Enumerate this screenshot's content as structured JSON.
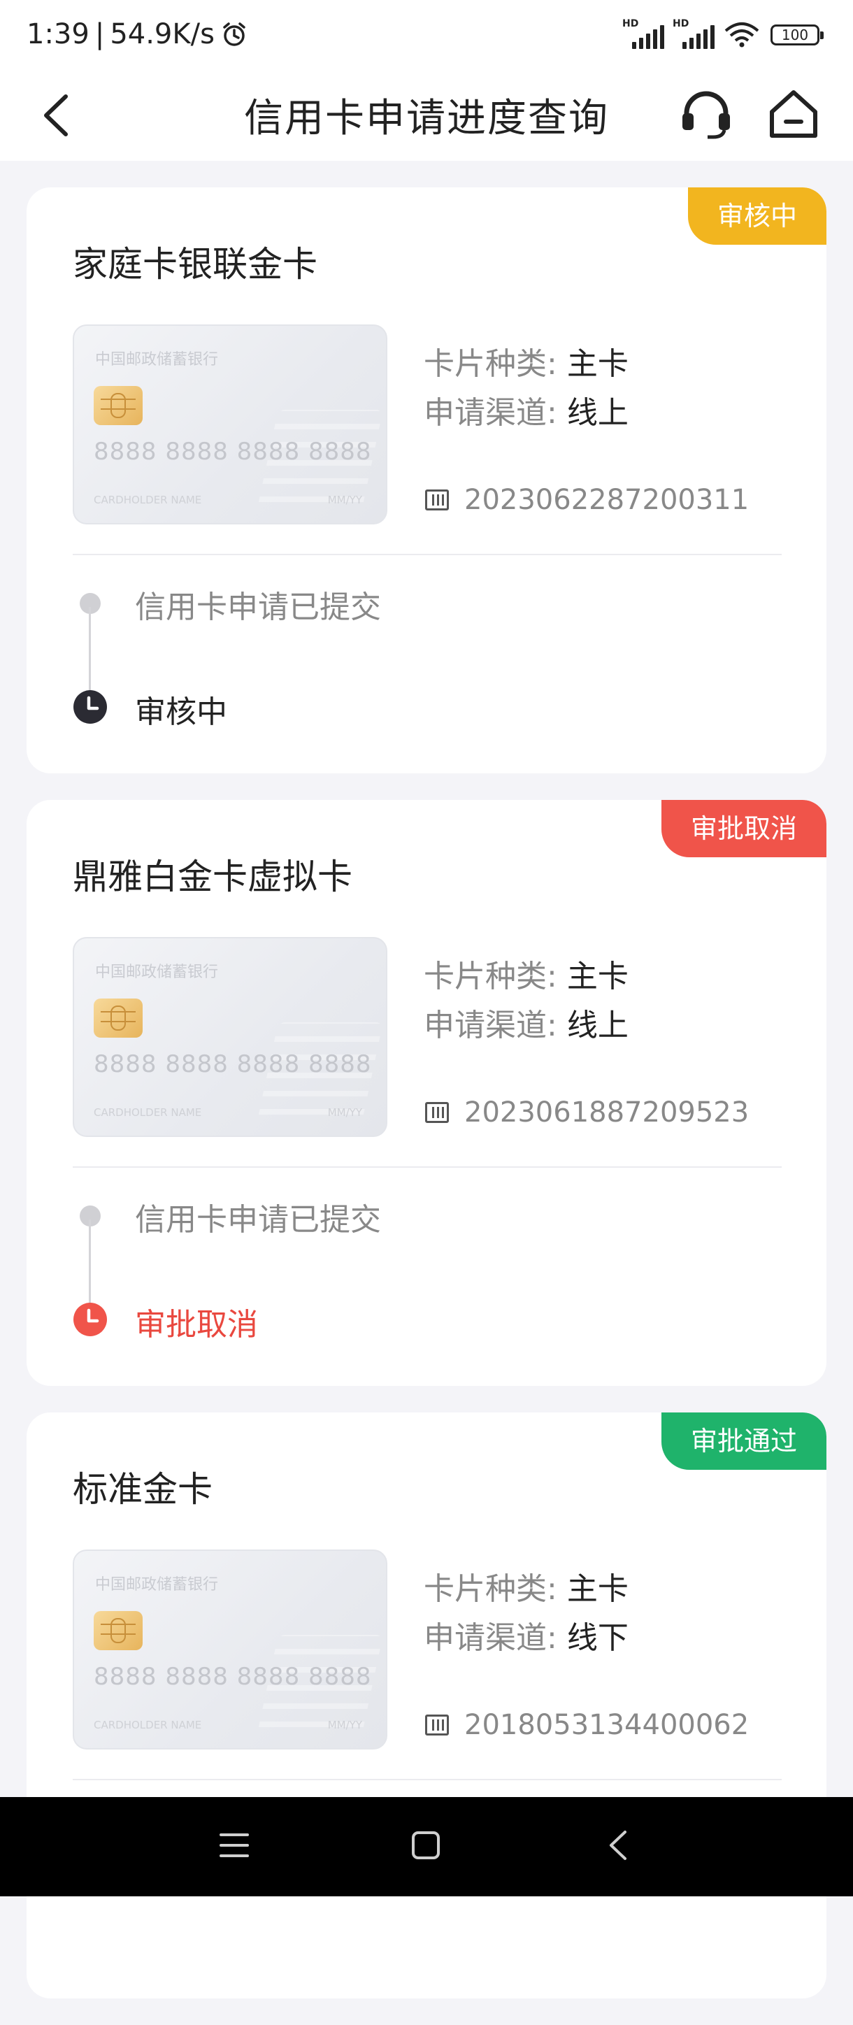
{
  "status_bar": {
    "time": "1:39",
    "network_speed": "54.9K/s",
    "signal1_label": "HD",
    "signal2_label": "HD",
    "battery": "100"
  },
  "header": {
    "title": "信用卡申请进度查询",
    "back_icon": "back-arrow-icon",
    "service_icon": "headset-icon",
    "home_icon": "home-icon"
  },
  "card_template": {
    "bank_name": "中国邮政储蓄银行",
    "card_number": "8888 8888 8888 8888",
    "holder": "CARDHOLDER NAME",
    "expiry": "MM/YY"
  },
  "applications": [
    {
      "name": "家庭卡银联金卡",
      "status": "审核中",
      "status_color": "#F2B51F",
      "card_type_label": "卡片种类:",
      "card_type": "主卡",
      "channel_label": "申请渠道:",
      "channel": "线上",
      "application_no": "2023062287200311",
      "step1": "信用卡申请已提交",
      "step2": "审核中",
      "step2_color": "#222222",
      "clock_color": "#2b2b33"
    },
    {
      "name": "鼎雅白金卡虚拟卡",
      "status": "审批取消",
      "status_color": "#F0544A",
      "card_type_label": "卡片种类:",
      "card_type": "主卡",
      "channel_label": "申请渠道:",
      "channel": "线上",
      "application_no": "2023061887209523",
      "step1": "信用卡申请已提交",
      "step2": "审批取消",
      "step2_color": "#E9483F",
      "clock_color": "#F0544A"
    },
    {
      "name": "标准金卡",
      "status": "审批通过",
      "status_color": "#1FB36B",
      "card_type_label": "卡片种类:",
      "card_type": "主卡",
      "channel_label": "申请渠道:",
      "channel": "线下",
      "application_no": "2018053134400062"
    }
  ],
  "nav_bar": {
    "menu_icon": "menu-icon",
    "home_icon": "square-home-icon",
    "back_icon": "triangle-back-icon"
  }
}
